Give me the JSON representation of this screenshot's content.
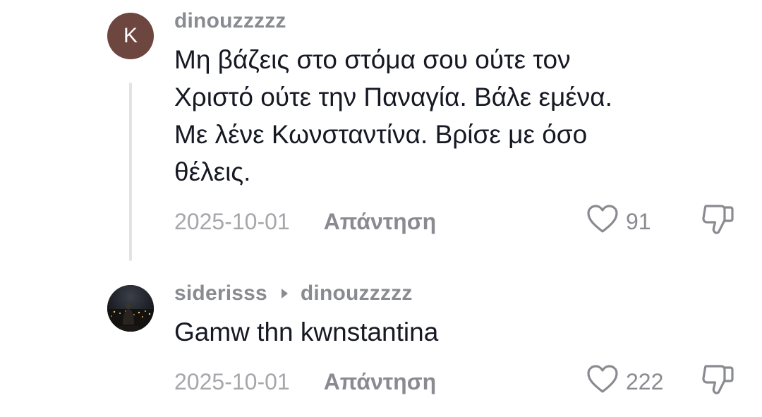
{
  "comments": [
    {
      "username": "dinouzzzzz",
      "avatar_letter": "K",
      "text_lines": [
        "Μη βάζεις στο στόμα σου ούτε τον",
        "Χριστό ούτε την Παναγία. Βάλε εμένα.",
        "Με λένε Κωνσταντίνα. Βρίσε με όσο",
        "θέλεις."
      ],
      "date": "2025-10-01",
      "reply_label": "Απάντηση",
      "like_count": "91"
    },
    {
      "username": "siderisss",
      "reply_to": "dinouzzzzz",
      "text_lines": [
        "Gamw thn kwnstantina"
      ],
      "date": "2025-10-01",
      "reply_label": "Απάντηση",
      "like_count": "222"
    }
  ],
  "icons": {
    "like": "heart-outline-icon",
    "dislike": "thumbs-down-outline-icon",
    "reply_indicator": "caret-right-icon"
  },
  "colors": {
    "text_primary": "#161823",
    "text_secondary": "#8a8b91",
    "date": "#a6a7ab",
    "avatar_letter_bg": "#6e4640",
    "thread_line": "#e3e3e6"
  }
}
